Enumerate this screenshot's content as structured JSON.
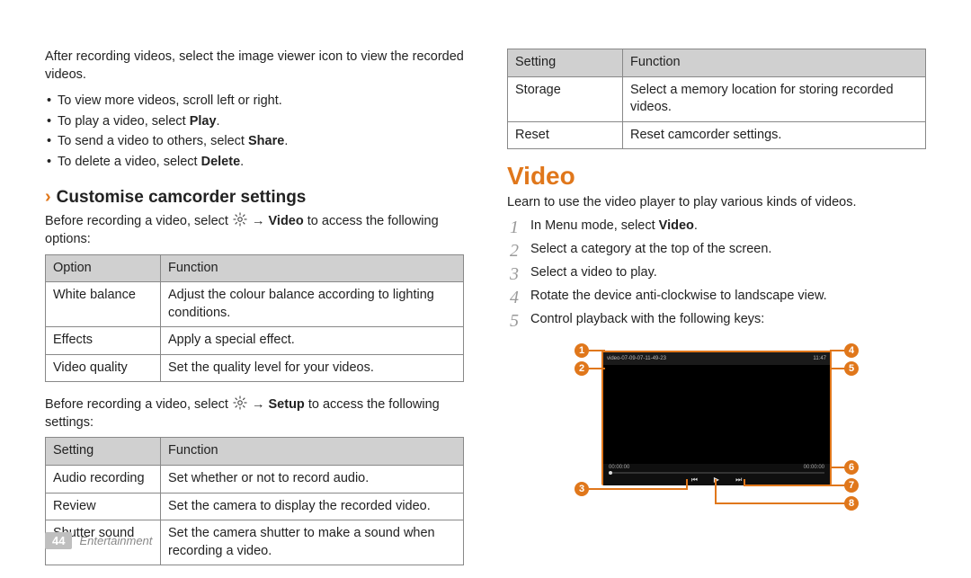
{
  "footer": {
    "page": "44",
    "section": "Entertainment"
  },
  "left": {
    "intro": "After recording videos, select the image viewer icon to view the recorded videos.",
    "bullets": {
      "b1": "To view more videos, scroll left or right.",
      "b2_pre": "To play a video, select ",
      "b2_strong": "Play",
      "b2_post": ".",
      "b3_pre": "To send a video to others, select ",
      "b3_strong": "Share",
      "b3_post": ".",
      "b4_pre": "To delete a video, select ",
      "b4_strong": "Delete",
      "b4_post": "."
    },
    "subheading": "Customise camcorder settings",
    "before_options_pre": "Before recording a video, select ",
    "before_options_arrow": " → ",
    "before_options_strong": "Video",
    "before_options_post": " to access the following options:",
    "options_table": {
      "h1": "Option",
      "h2": "Function",
      "r1c1": "White balance",
      "r1c2": "Adjust the colour balance according to lighting conditions.",
      "r2c1": "Effects",
      "r2c2": "Apply a special effect.",
      "r3c1": "Video quality",
      "r3c2": "Set the quality level for your videos."
    },
    "before_settings_pre": "Before recording a video, select ",
    "before_settings_arrow": " → ",
    "before_settings_strong": "Setup",
    "before_settings_post": " to access the following settings:",
    "settings_table": {
      "h1": "Setting",
      "h2": "Function",
      "r1c1": "Audio recording",
      "r1c2": "Set whether or not to record audio.",
      "r2c1": "Review",
      "r2c2": "Set the camera to display the recorded video.",
      "r3c1": "Shutter sound",
      "r3c2": "Set the camera shutter to make a sound when recording a video."
    }
  },
  "right": {
    "settings_table_cont": {
      "h1": "Setting",
      "h2": "Function",
      "r1c1": "Storage",
      "r1c2": "Select a memory location for storing recorded videos.",
      "r2c1": "Reset",
      "r2c2": "Reset camcorder settings."
    },
    "heading": "Video",
    "lead": "Learn to use the video player to play various kinds of videos.",
    "steps": {
      "s1_pre": "In Menu mode, select ",
      "s1_strong": "Video",
      "s1_post": ".",
      "s2": "Select a category at the top of the screen.",
      "s3": "Select a video to play.",
      "s4": "Rotate the device anti-clockwise to landscape view.",
      "s5": "Control playback with the following keys:"
    },
    "step_nums": {
      "n1": "1",
      "n2": "2",
      "n3": "3",
      "n4": "4",
      "n5": "5"
    },
    "callouts": {
      "c1": "1",
      "c2": "2",
      "c3": "3",
      "c4": "4",
      "c5": "5",
      "c6": "6",
      "c7": "7",
      "c8": "8"
    },
    "player": {
      "title": "video-07-09-07-11-49-23",
      "time_left": "00:00:00",
      "time_right": "00:00:00",
      "clock": "11:47"
    }
  }
}
